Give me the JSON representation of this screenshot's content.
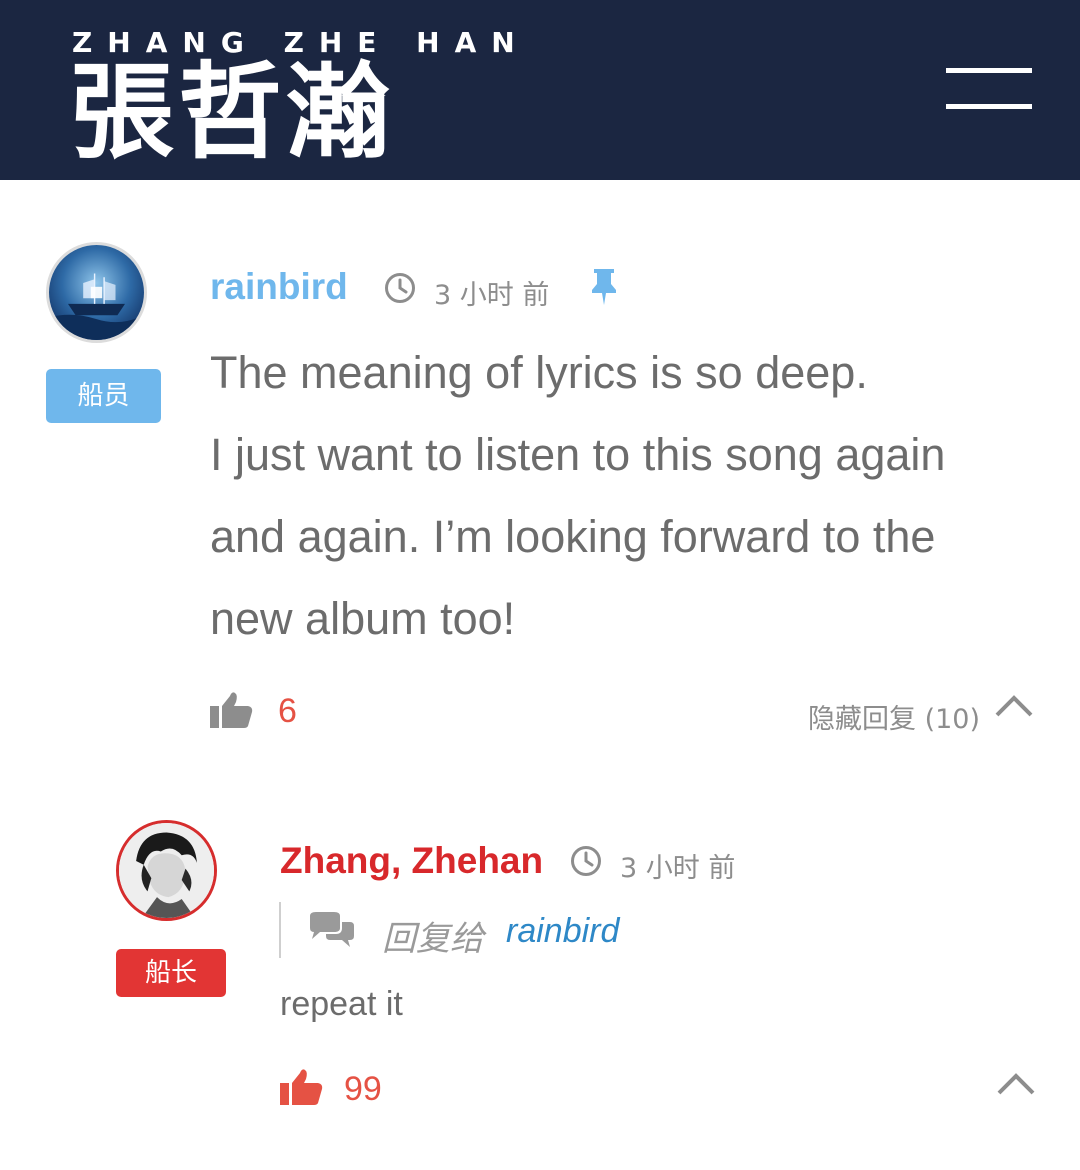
{
  "header": {
    "brand_subtitle": "ZHANG ZHE HAN",
    "brand_title": "張哲瀚",
    "menu_icon": "hamburger-menu-icon"
  },
  "colors": {
    "header_bg": "#1b2641",
    "crew_blue": "#6fb7ec",
    "captain_red": "#e23534",
    "like_red": "#e55244",
    "link_blue": "#2e88c7"
  },
  "comment": {
    "username": "rainbird",
    "role": "船员",
    "time_ago": "3 小时 前",
    "pinned": true,
    "body_lines": [
      "The meaning of lyrics is so deep.",
      "I just want to listen to this song again",
      "and again. I’m looking forward to the",
      "new album too!"
    ],
    "likes": "6",
    "hide_replies_label": "隐藏回复 (10)"
  },
  "reply": {
    "username": "Zhang, Zhehan",
    "role": "船长",
    "time_ago": "3 小时 前",
    "reply_to_label": "回复给",
    "reply_to_user": "rainbird",
    "text": "repeat it",
    "likes": "99"
  }
}
